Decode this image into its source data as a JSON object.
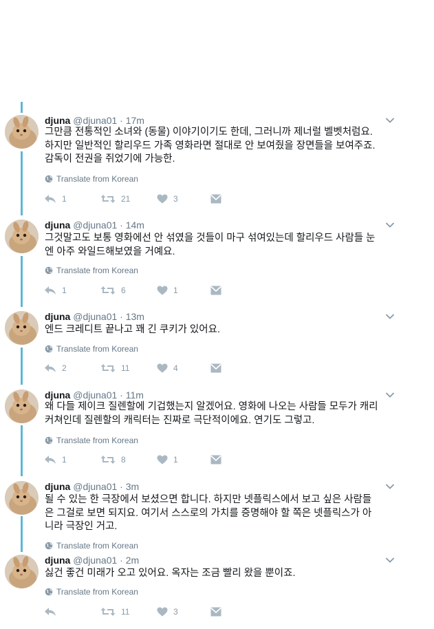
{
  "colors": {
    "accent_thread": "#5eb6d6",
    "icon_gray": "#8899a6",
    "text_gray": "#657786"
  },
  "tweets": [
    {
      "name": "djuna",
      "handle": "@djuna01",
      "separator": "·",
      "time": "17m",
      "lines": [
        "그만큼 전통적인 소녀와 (동물) 이야기이기도 한데, 그러니까 제너럴 벨벳처럼요.",
        "하지만 일반적인 할리우드 가족 영화라면 절대로 안 보여줬을 장면들을 보여주죠.",
        "감독이 전권을 쥐었기에 가능한."
      ],
      "translate_label": "Translate from Korean",
      "replies": "1",
      "retweets": "21",
      "likes": "3"
    },
    {
      "name": "djuna",
      "handle": "@djuna01",
      "separator": "·",
      "time": "14m",
      "lines": [
        "그것말고도 보통 영화에선 안 섞였을 것들이 마구 섞여있는데 할리우드 사람들 눈",
        "엔 아주 와일드해보였을 거예요."
      ],
      "translate_label": "Translate from Korean",
      "replies": "1",
      "retweets": "6",
      "likes": "1"
    },
    {
      "name": "djuna",
      "handle": "@djuna01",
      "separator": "·",
      "time": "13m",
      "lines": [
        "엔드 크레디트 끝나고 꽤 긴 쿠키가 있어요."
      ],
      "translate_label": "Translate from Korean",
      "replies": "2",
      "retweets": "11",
      "likes": "4"
    },
    {
      "name": "djuna",
      "handle": "@djuna01",
      "separator": "·",
      "time": "11m",
      "lines": [
        "왜 다들 제이크 질렌할에 기겁했는지 알겠어요. 영화에 나오는 사람들 모두가 캐리",
        "커쳐인데 질렌할의 캐릭터는 진짜로 극단적이에요. 연기도 그렇고."
      ],
      "translate_label": "Translate from Korean",
      "replies": "1",
      "retweets": "8",
      "likes": "1"
    },
    {
      "name": "djuna",
      "handle": "@djuna01",
      "separator": "·",
      "time": "3m",
      "lines": [
        "될 수 있는 한 극장에서 보셨으면 합니다. 하지만 넷플릭스에서 보고 싶은 사람들",
        "은 그걸로 보면 되지요. 여기서 스스로의 가치를 증명해야 할 쪽은 넷플릭스가 아",
        "니라 극장인 거고."
      ],
      "translate_label": "Translate from Korean",
      "replies": "",
      "retweets": "",
      "likes": ""
    },
    {
      "name": "djuna",
      "handle": "@djuna01",
      "separator": "·",
      "time": "2m",
      "lines": [
        "싫건 좋건 미래가 오고 있어요. 옥자는 조금 빨리 왔을 뿐이죠."
      ],
      "translate_label": "Translate from Korean",
      "replies": "",
      "retweets": "11",
      "likes": "3"
    }
  ]
}
